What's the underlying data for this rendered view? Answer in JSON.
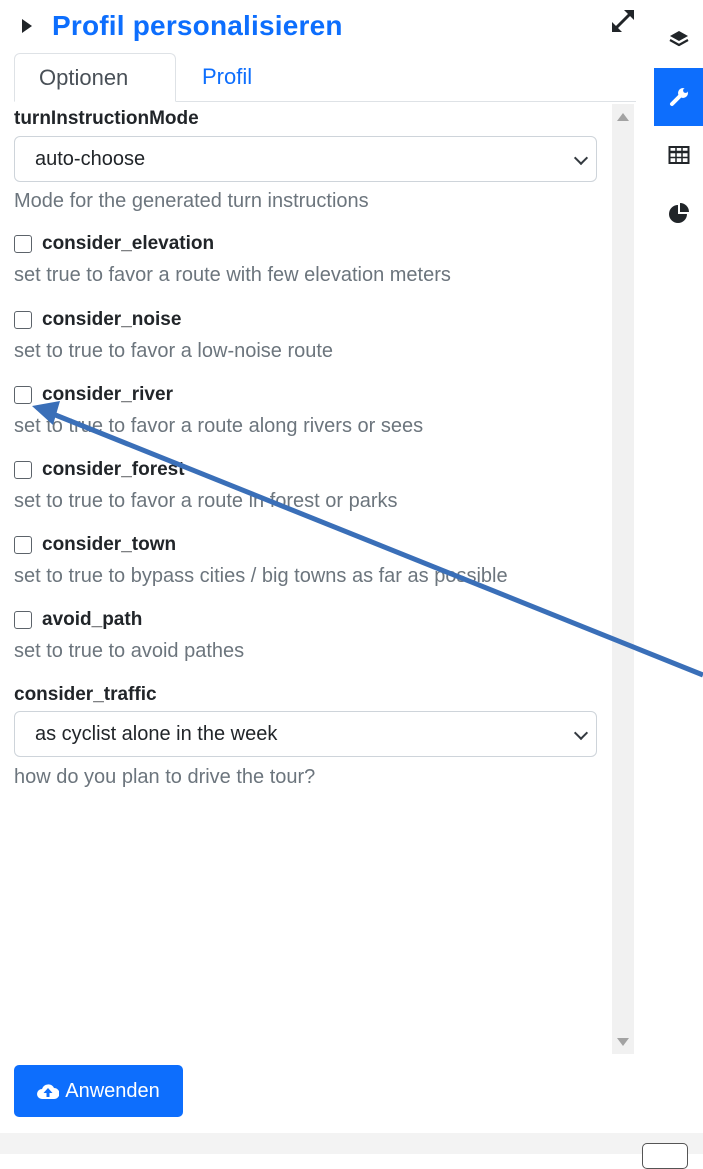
{
  "header": {
    "title": "Profil personalisieren"
  },
  "tabs": [
    {
      "label": "Optionen",
      "active": true
    },
    {
      "label": "Profil",
      "active": false
    }
  ],
  "options": {
    "turn_mode": {
      "label": "turnInstructionMode",
      "value": "auto-choose",
      "help": "Mode for the generated turn instructions"
    },
    "checkboxes": [
      {
        "label": "consider_elevation",
        "checked": false,
        "help": "set true to favor a route with few elevation meters"
      },
      {
        "label": "consider_noise",
        "checked": false,
        "help": "set to true to favor a low-noise route"
      },
      {
        "label": "consider_river",
        "checked": false,
        "help": "set to true to favor a route along rivers or sees"
      },
      {
        "label": "consider_forest",
        "checked": false,
        "help": "set to true to favor a route in forest or parks"
      },
      {
        "label": "consider_town",
        "checked": false,
        "help": "set to true to bypass cities / big towns as far as possible"
      },
      {
        "label": "avoid_path",
        "checked": false,
        "help": "set to true to avoid pathes"
      }
    ],
    "traffic": {
      "label": "consider_traffic",
      "value": "as cyclist alone in the week",
      "help": "how do you plan to drive the tour?"
    }
  },
  "apply_button": {
    "label": "Anwenden",
    "icon": "cloud-upload-icon"
  },
  "sidebar": {
    "items": [
      {
        "icon": "layers-icon",
        "active": false
      },
      {
        "icon": "wrench-icon",
        "active": true
      },
      {
        "icon": "table-icon",
        "active": false
      },
      {
        "icon": "pie-chart-icon",
        "active": false
      }
    ]
  },
  "colors": {
    "accent": "#0d6efd",
    "annotation_arrow": "#3a6fb8",
    "muted_text": "#6c757d"
  }
}
